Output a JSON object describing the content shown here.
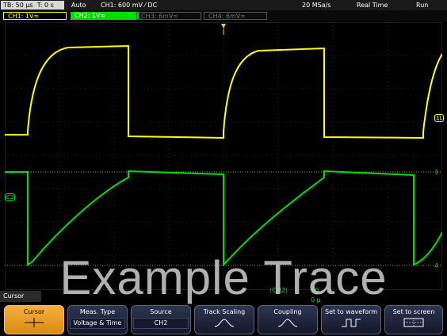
{
  "status": {
    "timebase": "TB: 50 µs",
    "trigger_time": "T: 0 s",
    "mode": "Auto",
    "trigger_info": "CH1: 600 mV ⁄ DC",
    "sample_rate": "20 MSa/s",
    "acq_mode": "Real Time",
    "run_state": "Run"
  },
  "channels": [
    {
      "label": "CH1: 1V≈",
      "color": "#ffff00",
      "active": true
    },
    {
      "label": "CH2: 1V≈",
      "color": "#00e000",
      "active": true
    },
    {
      "label": "CH3: 6mV≈",
      "color": "#777777",
      "active": false
    },
    {
      "label": "CH4: 6mV≈",
      "color": "#777777",
      "active": false
    }
  ],
  "markers": {
    "ch1_ref": "1L",
    "ch2_ref": "C2",
    "cursor_3": "3",
    "cursor_4": "4",
    "trigger_marker": "T"
  },
  "measurement": {
    "source_label": "(CH2)",
    "partial_a": "50",
    "partial_b": "0 µ"
  },
  "watermark": "Example Trace",
  "softkeys": {
    "menu_tab": "Cursor",
    "items": [
      {
        "title": "Cursor",
        "value": "",
        "icon": "cursor-icon",
        "active": true
      },
      {
        "title": "Meas. Type",
        "value": "Voltage & Time",
        "icon": ""
      },
      {
        "title": "Source",
        "value": "CH2",
        "icon": ""
      },
      {
        "title": "Track Scaling",
        "value": "",
        "icon": "track-scaling-icon"
      },
      {
        "title": "Coupling",
        "value": "",
        "icon": "coupling-icon"
      },
      {
        "title": "Set to waveform",
        "value": "",
        "icon": "set-waveform-icon"
      },
      {
        "title": "Set to screen",
        "value": "",
        "icon": "set-screen-icon"
      }
    ]
  },
  "colors": {
    "ch1": "#ffff00",
    "ch2": "#00e000",
    "accent": "#f5a623",
    "trigger": "#ffcc00"
  }
}
